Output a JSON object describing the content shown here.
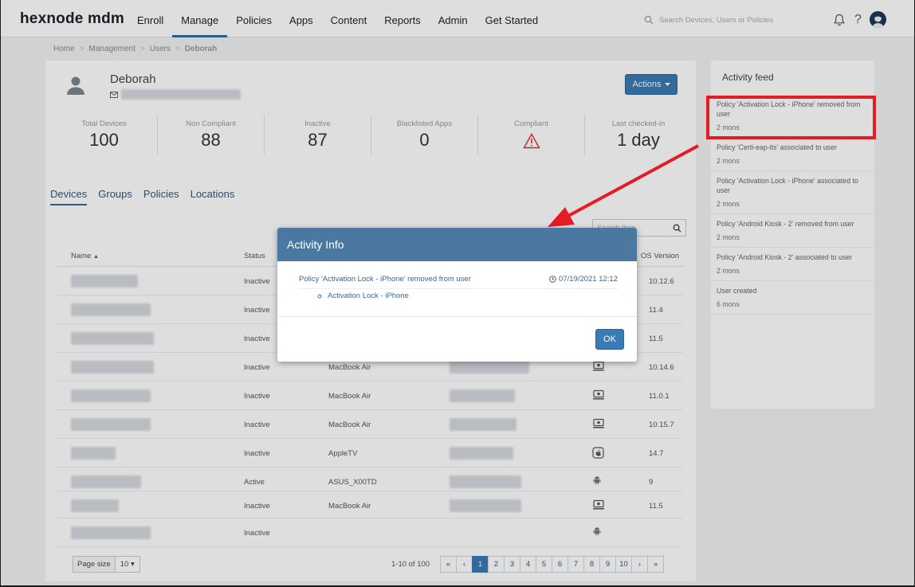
{
  "app": {
    "logo": "hexnode mdm",
    "nav": [
      "Enroll",
      "Manage",
      "Policies",
      "Apps",
      "Content",
      "Reports",
      "Admin",
      "Get Started"
    ],
    "active_nav": "Manage",
    "search_placeholder": "Search Devices, Users or Policies",
    "help_label": "?"
  },
  "breadcrumb": [
    "Home",
    "Management",
    "Users",
    "Deborah"
  ],
  "user": {
    "name": "Deborah",
    "actions_label": "Actions"
  },
  "stats": [
    {
      "label": "Total Devices",
      "value": "100"
    },
    {
      "label": "Non Compliant",
      "value": "88"
    },
    {
      "label": "Inactive",
      "value": "87"
    },
    {
      "label": "Blacklisted Apps",
      "value": "0"
    },
    {
      "label": "Compliant",
      "value": ""
    },
    {
      "label": "Last checked-in",
      "value": "1 day"
    }
  ],
  "tabs": [
    "Devices",
    "Groups",
    "Policies",
    "Locations"
  ],
  "table": {
    "search_placeholder": "Search Item",
    "columns": {
      "name": "Name",
      "status": "Status",
      "os_version": "OS Version"
    },
    "rows": [
      {
        "status": "Inactive",
        "model": "",
        "platform": "",
        "os": "10.12.6"
      },
      {
        "status": "Inactive",
        "model": "",
        "platform": "",
        "os": "11.4"
      },
      {
        "status": "Inactive",
        "model": "",
        "platform": "",
        "os": "11.5"
      },
      {
        "status": "Inactive",
        "model": "MacBook Air",
        "platform": "mac",
        "os": "10.14.6"
      },
      {
        "status": "Inactive",
        "model": "MacBook Air",
        "platform": "mac",
        "os": "11.0.1"
      },
      {
        "status": "Inactive",
        "model": "MacBook Air",
        "platform": "mac",
        "os": "10.15.7"
      },
      {
        "status": "Inactive",
        "model": "AppleTV",
        "platform": "apple",
        "os": "14.7"
      },
      {
        "status": "Active",
        "model": "ASUS_X00TD",
        "platform": "android",
        "os": "9"
      },
      {
        "status": "Inactive",
        "model": "MacBook Air",
        "platform": "mac",
        "os": "11.5"
      },
      {
        "status": "Inactive",
        "model": "",
        "platform": "android",
        "os": ""
      }
    ],
    "page_size_label": "Page size",
    "page_size": "10",
    "range": "1-10 of 100",
    "pages": [
      "«",
      "‹",
      "1",
      "2",
      "3",
      "4",
      "5",
      "6",
      "7",
      "8",
      "9",
      "10",
      "›",
      "»"
    ],
    "active_page": "1"
  },
  "feed": {
    "title": "Activity feed",
    "items": [
      {
        "text": "Policy 'Activation Lock - iPhone' removed from user",
        "time": "2 mons"
      },
      {
        "text": "Policy 'Certi-eap-tls' associated to user",
        "time": "2 mons"
      },
      {
        "text": "Policy 'Activation Lock - iPhone' associated to user",
        "time": "2 mons"
      },
      {
        "text": "Policy 'Android Kiosk - 2' removed from user",
        "time": "2 mons"
      },
      {
        "text": "Policy 'Android Kiosk - 2' associated to user",
        "time": "2 mons"
      },
      {
        "text": "User created",
        "time": "6 mons"
      }
    ]
  },
  "modal": {
    "title": "Activity Info",
    "message": "Policy 'Activation Lock - iPhone' removed from user",
    "timestamp": "07/19/2021 12:12",
    "sub_item": "Activation Lock - iPhone",
    "ok_label": "OK"
  },
  "colors": {
    "accent": "#3a7ab5",
    "modal_header": "#4a78a0",
    "highlight": "#e51c23",
    "warning": "#d9342b"
  }
}
